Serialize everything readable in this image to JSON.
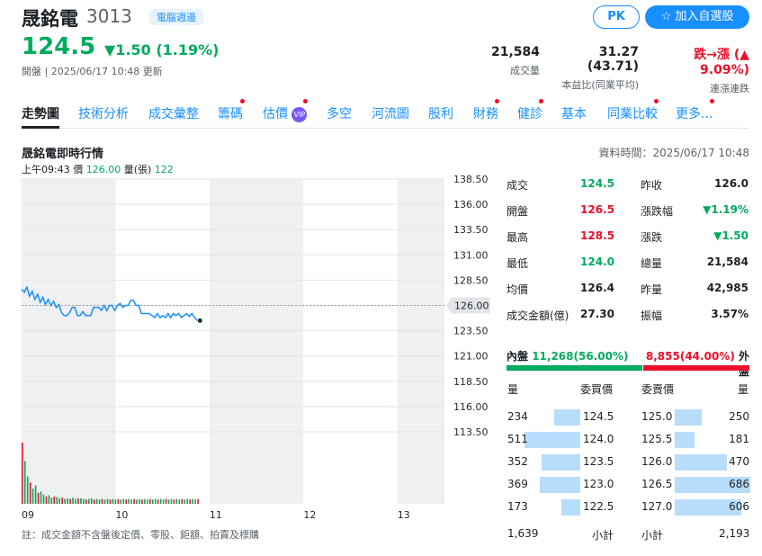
{
  "header": {
    "name": "晟銘電",
    "code": "3013",
    "tag": "電腦週邊",
    "price": "124.5",
    "change": "▼1.50 (1.19%)",
    "status": "開盤 | 2025/06/17 10:48 更新",
    "pk_label": "PK",
    "watch_label": "加入自選股",
    "stats": [
      {
        "value": "21,584",
        "label": "成交量"
      },
      {
        "value": "31.27 (43.71)",
        "label": "本益比(同業平均)"
      },
      {
        "value": "跌→漲 (▲ 9.09%)",
        "label": "連漲連跌"
      }
    ]
  },
  "nav": [
    "走勢圖",
    "技術分析",
    "成交彙整",
    "籌碼",
    "估價",
    "多空",
    "河流圖",
    "股利",
    "財務",
    "健診",
    "基本",
    "同業比較",
    "更多..."
  ],
  "nav_vip": "VIP",
  "chart": {
    "title": "晟銘電即時行情",
    "data_time": "資料時間：2025/06/17 10:48",
    "info_time": "上午09:43",
    "info_price_label": "價",
    "info_price": "126.00",
    "info_vol_label": "量(張)",
    "info_vol": "122",
    "current_price_tag": "126.00"
  },
  "chart_data": {
    "type": "line",
    "x_ticks": [
      "09",
      "10",
      "11",
      "12",
      "13"
    ],
    "y_ticks": [
      "138.50",
      "136.00",
      "133.50",
      "131.00",
      "128.50",
      "126.00",
      "123.50",
      "121.00",
      "118.50",
      "116.00",
      "113.50"
    ],
    "reference_price": 126.0,
    "ylim": [
      113.5,
      138.5
    ],
    "price_series": [
      127.6,
      127.3,
      127.8,
      126.9,
      127.4,
      126.6,
      127.1,
      126.3,
      126.8,
      126.1,
      126.6,
      126.0,
      126.4,
      125.8,
      126.1,
      125.3,
      125.0,
      125.0,
      125.3,
      125.8,
      125.8,
      125.0,
      125.0,
      125.4,
      125.0,
      125.0,
      125.0,
      125.8,
      125.8,
      125.8,
      125.5,
      126.0,
      125.5,
      126.0,
      126.0,
      125.5,
      126.0,
      126.2,
      125.8,
      126.0,
      126.0,
      126.5,
      126.5,
      126.0,
      126.0,
      125.2,
      125.2,
      125.2,
      125.2,
      125.0,
      124.8,
      125.2,
      124.8,
      125.0,
      124.8,
      125.2,
      124.8,
      125.2,
      125.0,
      125.2,
      124.8,
      125.0,
      125.2,
      124.9,
      125.2,
      124.8,
      124.5
    ],
    "volume_series": [
      100,
      70,
      45,
      35,
      25,
      30,
      18,
      20,
      15,
      12,
      14,
      10,
      12,
      11,
      9,
      10,
      8,
      9,
      8,
      10,
      8,
      9,
      9,
      8,
      7,
      8,
      9,
      7,
      8,
      7,
      8,
      7,
      8,
      7,
      8,
      7,
      8,
      7,
      8,
      7,
      8,
      7,
      8,
      7,
      8,
      7,
      8,
      7,
      8,
      7,
      8,
      7,
      8,
      7,
      8,
      7,
      8,
      7,
      8,
      7,
      8,
      7,
      8,
      7,
      8,
      7,
      8
    ],
    "colors": {
      "line": "#188fff",
      "up": "#eb0f29",
      "down": "#00ab5e"
    }
  },
  "quote": {
    "left": [
      {
        "label": "成交",
        "value": "124.5",
        "color": "down"
      },
      {
        "label": "開盤",
        "value": "126.5",
        "color": "up"
      },
      {
        "label": "最高",
        "value": "128.5",
        "color": "up"
      },
      {
        "label": "最低",
        "value": "124.0",
        "color": "down"
      },
      {
        "label": "均價",
        "value": "126.4",
        "color": "neutral"
      },
      {
        "label": "成交金額(億)",
        "value": "27.30",
        "color": "neutral"
      }
    ],
    "right": [
      {
        "label": "昨收",
        "value": "126.0",
        "color": "neutral"
      },
      {
        "label": "漲跌幅",
        "value": "▼1.19%",
        "color": "down"
      },
      {
        "label": "漲跌",
        "value": "▼1.50",
        "color": "down"
      },
      {
        "label": "總量",
        "value": "21,584",
        "color": "neutral"
      },
      {
        "label": "昨量",
        "value": "42,985",
        "color": "neutral"
      },
      {
        "label": "振幅",
        "value": "3.57%",
        "color": "neutral"
      }
    ]
  },
  "inout": {
    "inner_label": "內盤",
    "inner_value": "11,268(56.00%)",
    "outer_value": "8,855(44.00%)",
    "outer_label": "外盤",
    "inner_pct": 56.0
  },
  "orders": {
    "bid_headers": [
      "量",
      "委買價"
    ],
    "ask_headers": [
      "委賣價",
      "量"
    ],
    "bids": [
      {
        "vol": "234",
        "price": "124.5",
        "ratio": 0.46
      },
      {
        "vol": "511",
        "price": "124.0",
        "ratio": 1.0
      },
      {
        "vol": "352",
        "price": "123.5",
        "ratio": 0.69
      },
      {
        "vol": "369",
        "price": "123.0",
        "ratio": 0.72
      },
      {
        "vol": "173",
        "price": "122.5",
        "ratio": 0.34
      }
    ],
    "asks": [
      {
        "price": "125.0",
        "vol": "250",
        "ratio": 0.36
      },
      {
        "price": "125.5",
        "vol": "181",
        "ratio": 0.26
      },
      {
        "price": "126.0",
        "vol": "470",
        "ratio": 0.69
      },
      {
        "price": "126.5",
        "vol": "686",
        "ratio": 1.0
      },
      {
        "price": "127.0",
        "vol": "606",
        "ratio": 0.88
      }
    ],
    "bid_total_vol": "1,639",
    "bid_total_label": "小計",
    "ask_total_label": "小計",
    "ask_total_vol": "2,193"
  },
  "note": "註：成交金額不含盤後定價、零股、鉅額、拍賣及標購"
}
